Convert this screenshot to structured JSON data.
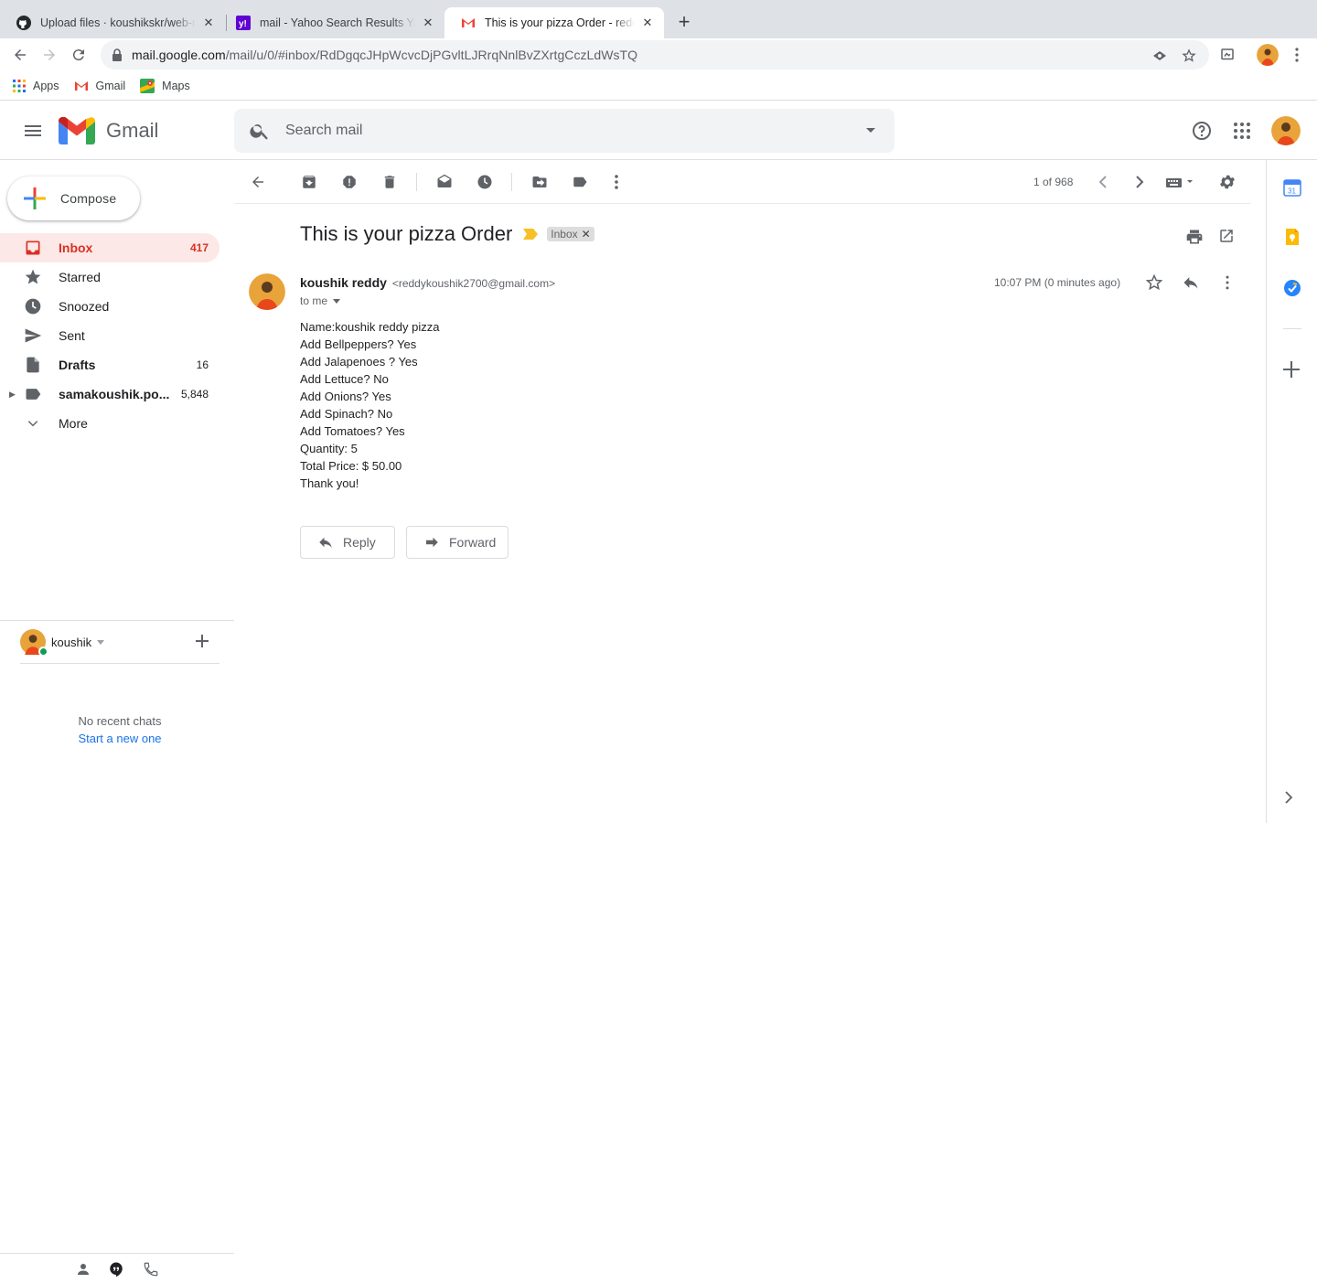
{
  "browser": {
    "tabs": [
      {
        "title": "Upload files · koushikskr/web-m",
        "favicon": "github-icon"
      },
      {
        "title": "mail - Yahoo Search Results Yah",
        "favicon": "yahoo-icon"
      },
      {
        "title": "This is your pizza Order - reddyk",
        "favicon": "gmail-icon",
        "active": true
      }
    ],
    "url_host": "mail.google.com",
    "url_path": "/mail/u/0/#inbox/RdDgqcJHpWcvcDjPGvltLJRrqNnlBvZXrtgCczLdWsTQ",
    "bookmarks": [
      "Apps",
      "Gmail",
      "Maps"
    ]
  },
  "gmail": {
    "product_name": "Gmail",
    "search_placeholder": "Search mail"
  },
  "sidebar": {
    "compose_label": "Compose",
    "items": [
      {
        "label": "Inbox",
        "count": "417",
        "icon": "inbox-icon"
      },
      {
        "label": "Starred",
        "count": "",
        "icon": "star-icon"
      },
      {
        "label": "Snoozed",
        "count": "",
        "icon": "clock-icon"
      },
      {
        "label": "Sent",
        "count": "",
        "icon": "send-icon"
      },
      {
        "label": "Drafts",
        "count": "16",
        "icon": "draft-icon"
      },
      {
        "label": "samakoushik.po...",
        "count": "5,848",
        "icon": "label-icon"
      },
      {
        "label": "More",
        "count": "",
        "icon": "chevron-down-icon"
      }
    ]
  },
  "hangouts": {
    "user_name": "koushik",
    "no_chats": "No recent chats",
    "start_new": "Start a new one"
  },
  "toolbar": {
    "pager": "1 of 968"
  },
  "message": {
    "subject": "This is your pizza Order",
    "label_badge": "Inbox",
    "sender_name": "koushik reddy",
    "sender_email": "<reddykoushik2700@gmail.com>",
    "to": "to me",
    "timestamp": "10:07 PM (0 minutes ago)",
    "body": [
      "Name:koushik reddy pizza",
      "Add Bellpeppers? Yes",
      "Add Jalapenoes ? Yes",
      "Add Lettuce? No",
      "Add Onions? Yes",
      "Add Spinach? No",
      "Add Tomatoes? Yes",
      "Quantity: 5",
      "Total Price: $ 50.00",
      "Thank you!"
    ],
    "reply_label": "Reply",
    "forward_label": "Forward"
  },
  "colors": {
    "accent_red": "#d93025",
    "active_bg": "#fce8e6",
    "link_blue": "#1a73e8",
    "important_yellow": "#f6c026"
  }
}
